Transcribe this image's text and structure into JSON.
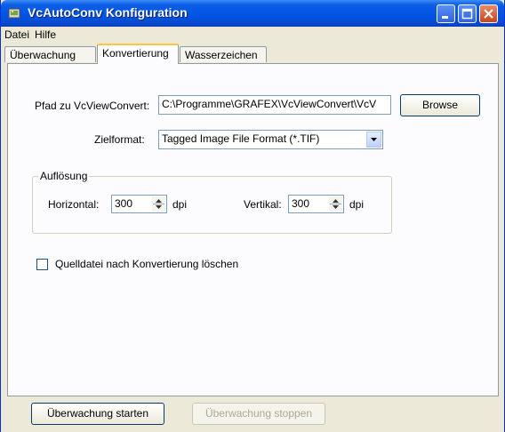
{
  "window": {
    "title": "VcAutoConv Konfiguration"
  },
  "menu": {
    "items": [
      "Datei",
      "Hilfe"
    ]
  },
  "tabs": [
    "Überwachung",
    "Konvertierung",
    "Wasserzeichen"
  ],
  "conversion": {
    "path_label": "Pfad zu VcViewConvert:",
    "path_value": "C:\\Programme\\GRAFEX\\VcViewConvert\\VcV",
    "browse_label": "Browse",
    "format_label": "Zielformat:",
    "format_value": "Tagged Image File Format (*.TIF)",
    "resolution": {
      "title": "Auflösung",
      "horizontal_label": "Horizontal:",
      "horizontal_value": "300",
      "horizontal_unit": "dpi",
      "vertical_label": "Vertikal:",
      "vertical_value": "300",
      "vertical_unit": "dpi"
    },
    "delete_source_label": "Quelldatei nach Konvertierung löschen",
    "delete_source_checked": false
  },
  "footer": {
    "start_label": "Überwachung starten",
    "stop_label": "Überwachung stoppen"
  },
  "colors": {
    "titlebar": "#0055e5",
    "tab_highlight": "#ffc83c",
    "window_bg": "#ece9d8"
  }
}
